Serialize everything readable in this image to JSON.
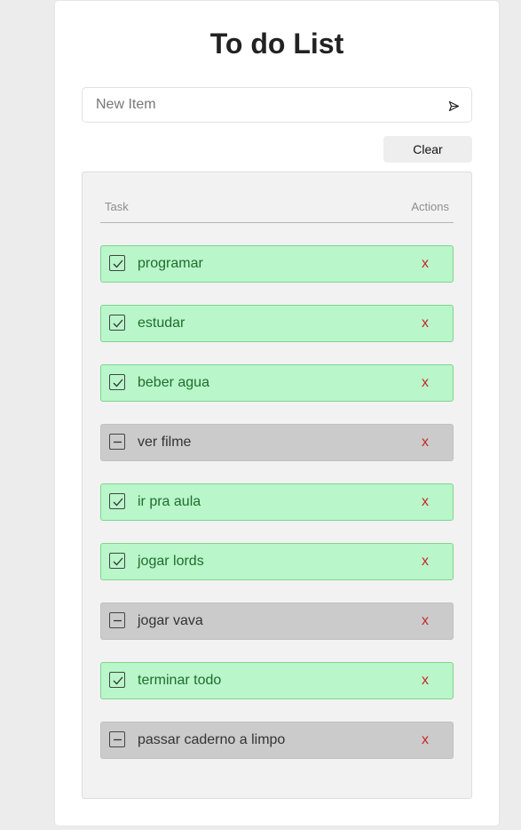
{
  "title": "To do List",
  "input": {
    "placeholder": "New Item",
    "value": "",
    "submit_icon": "send-icon"
  },
  "clear_label": "Clear",
  "list": {
    "header_task": "Task",
    "header_actions": "Actions",
    "items": [
      {
        "label": "programar",
        "done": true,
        "delete_label": "x"
      },
      {
        "label": "estudar",
        "done": true,
        "delete_label": "x"
      },
      {
        "label": "beber agua",
        "done": true,
        "delete_label": "x"
      },
      {
        "label": "ver filme",
        "done": false,
        "delete_label": "x"
      },
      {
        "label": "ir pra aula",
        "done": true,
        "delete_label": "x"
      },
      {
        "label": "jogar lords",
        "done": true,
        "delete_label": "x"
      },
      {
        "label": "jogar vava",
        "done": false,
        "delete_label": "x"
      },
      {
        "label": "terminar todo",
        "done": true,
        "delete_label": "x"
      },
      {
        "label": "passar caderno a limpo",
        "done": false,
        "delete_label": "x"
      }
    ]
  },
  "colors": {
    "done_background": "#b9f6ca",
    "pending_background": "#cbcbcb",
    "delete_color": "#c62828"
  }
}
